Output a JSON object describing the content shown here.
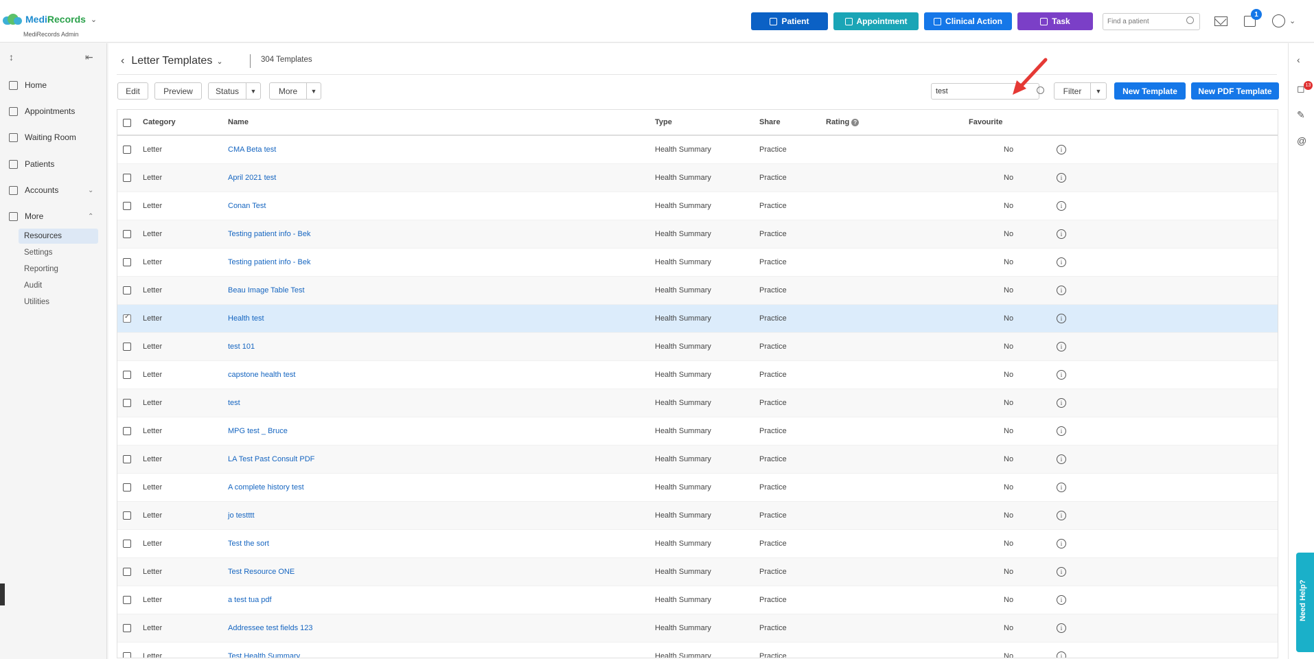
{
  "app": {
    "name_part1": "Medi",
    "name_part2": "Records",
    "subtitle": "MediRecords Admin"
  },
  "header": {
    "quick_actions": [
      {
        "label": "Patient",
        "color": "#0b61c5"
      },
      {
        "label": "Appointment",
        "color": "#1aa5b6"
      },
      {
        "label": "Clinical Action",
        "color": "#1577e8"
      },
      {
        "label": "Task",
        "color": "#7b3fc7"
      }
    ],
    "find_placeholder": "Find a patient",
    "calendar_badge": "1"
  },
  "sidebar": {
    "items": [
      {
        "label": "Home",
        "icon": "home-icon"
      },
      {
        "label": "Appointments",
        "icon": "calendar-icon"
      },
      {
        "label": "Waiting Room",
        "icon": "people-icon"
      },
      {
        "label": "Patients",
        "icon": "patients-icon"
      },
      {
        "label": "Accounts",
        "icon": "folder-icon"
      },
      {
        "label": "More",
        "icon": "more-folder-icon"
      }
    ],
    "sub_items": [
      {
        "label": "Resources",
        "active": true
      },
      {
        "label": "Settings",
        "active": false
      },
      {
        "label": "Reporting",
        "active": false
      },
      {
        "label": "Audit",
        "active": false
      },
      {
        "label": "Utilities",
        "active": false
      }
    ]
  },
  "page": {
    "title": "Letter Templates",
    "count": "304 Templates"
  },
  "toolbar": {
    "edit": "Edit",
    "preview": "Preview",
    "status": "Status",
    "more": "More",
    "search_value": "test",
    "filter": "Filter",
    "new_template": "New Template",
    "new_pdf_template": "New PDF Template"
  },
  "table": {
    "headers": {
      "category": "Category",
      "name": "Name",
      "type": "Type",
      "share": "Share",
      "rating": "Rating",
      "favourite": "Favourite"
    },
    "rows": [
      {
        "category": "Letter",
        "name": "CMA Beta test",
        "type": "Health Summary",
        "share": "Practice",
        "favourite": "No",
        "checked": false
      },
      {
        "category": "Letter",
        "name": "April 2021 test",
        "type": "Health Summary",
        "share": "Practice",
        "favourite": "No",
        "checked": false
      },
      {
        "category": "Letter",
        "name": "Conan Test",
        "type": "Health Summary",
        "share": "Practice",
        "favourite": "No",
        "checked": false
      },
      {
        "category": "Letter",
        "name": "Testing patient info - Bek",
        "type": "Health Summary",
        "share": "Practice",
        "favourite": "No",
        "checked": false
      },
      {
        "category": "Letter",
        "name": "Testing patient info - Bek",
        "type": "Health Summary",
        "share": "Practice",
        "favourite": "No",
        "checked": false
      },
      {
        "category": "Letter",
        "name": "Beau Image Table Test",
        "type": "Health Summary",
        "share": "Practice",
        "favourite": "No",
        "checked": false
      },
      {
        "category": "Letter",
        "name": "Health test",
        "type": "Health Summary",
        "share": "Practice",
        "favourite": "No",
        "checked": true
      },
      {
        "category": "Letter",
        "name": "test 101",
        "type": "Health Summary",
        "share": "Practice",
        "favourite": "No",
        "checked": false
      },
      {
        "category": "Letter",
        "name": "capstone health test",
        "type": "Health Summary",
        "share": "Practice",
        "favourite": "No",
        "checked": false
      },
      {
        "category": "Letter",
        "name": "test",
        "type": "Health Summary",
        "share": "Practice",
        "favourite": "No",
        "checked": false
      },
      {
        "category": "Letter",
        "name": "MPG test _ Bruce",
        "type": "Health Summary",
        "share": "Practice",
        "favourite": "No",
        "checked": false
      },
      {
        "category": "Letter",
        "name": "LA Test Past Consult PDF",
        "type": "Health Summary",
        "share": "Practice",
        "favourite": "No",
        "checked": false
      },
      {
        "category": "Letter",
        "name": "A complete history test",
        "type": "Health Summary",
        "share": "Practice",
        "favourite": "No",
        "checked": false
      },
      {
        "category": "Letter",
        "name": "jo testttt",
        "type": "Health Summary",
        "share": "Practice",
        "favourite": "No",
        "checked": false
      },
      {
        "category": "Letter",
        "name": "Test the sort",
        "type": "Health Summary",
        "share": "Practice",
        "favourite": "No",
        "checked": false
      },
      {
        "category": "Letter",
        "name": "Test Resource ONE",
        "type": "Health Summary",
        "share": "Practice",
        "favourite": "No",
        "checked": false
      },
      {
        "category": "Letter",
        "name": "a test tua pdf",
        "type": "Health Summary",
        "share": "Practice",
        "favourite": "No",
        "checked": false
      },
      {
        "category": "Letter",
        "name": "Addressee test fields 123",
        "type": "Health Summary",
        "share": "Practice",
        "favourite": "No",
        "checked": false
      },
      {
        "category": "Letter",
        "name": "Test Health Summary",
        "type": "Health Summary",
        "share": "Practice",
        "favourite": "No",
        "checked": false
      }
    ]
  },
  "right_panel": {
    "notification_badge": "13",
    "help_label": "Need Help?"
  },
  "colors": {
    "accent": "#1577e8",
    "link": "#1565c0",
    "selected_row": "#dcecfb",
    "annotation_arrow": "#e53935"
  }
}
